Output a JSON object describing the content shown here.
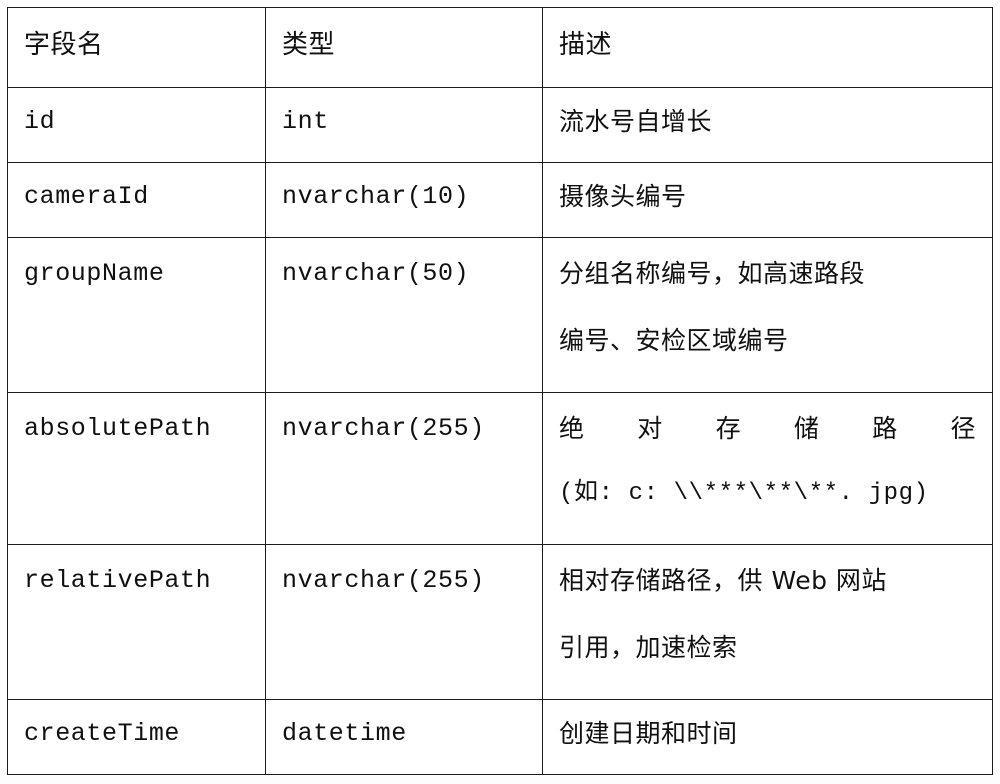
{
  "document": {
    "kind": "database-field-specification-table",
    "background_color": "#fdfdfd",
    "border_color": "#1c1c1c",
    "text_color": "#101010"
  },
  "table": {
    "headers": {
      "field": "字段名",
      "type": "类型",
      "description": "描述"
    },
    "rows": [
      {
        "field": "id",
        "type": "int",
        "desc_lines": [
          "流水号自增长"
        ]
      },
      {
        "field": "cameraId",
        "type": "nvarchar(10)",
        "desc_lines": [
          "摄像头编号"
        ]
      },
      {
        "field": "groupName",
        "type": "nvarchar(50)",
        "desc_lines": [
          "分组名称编号，如高速路段",
          "编号、安检区域编号"
        ]
      },
      {
        "field": "absolutePath",
        "type": "nvarchar(255)",
        "desc_lines": [
          "绝对存储路径",
          "(如: c: \\\\***\\**\\**. jpg)"
        ]
      },
      {
        "field": "relativePath",
        "type": "nvarchar(255)",
        "desc_lines": [
          "相对存储路径，供 Web 网站",
          "引用，加速检索"
        ]
      },
      {
        "field": "createTime",
        "type": "datetime",
        "desc_lines": [
          "创建日期和时间"
        ]
      }
    ]
  }
}
